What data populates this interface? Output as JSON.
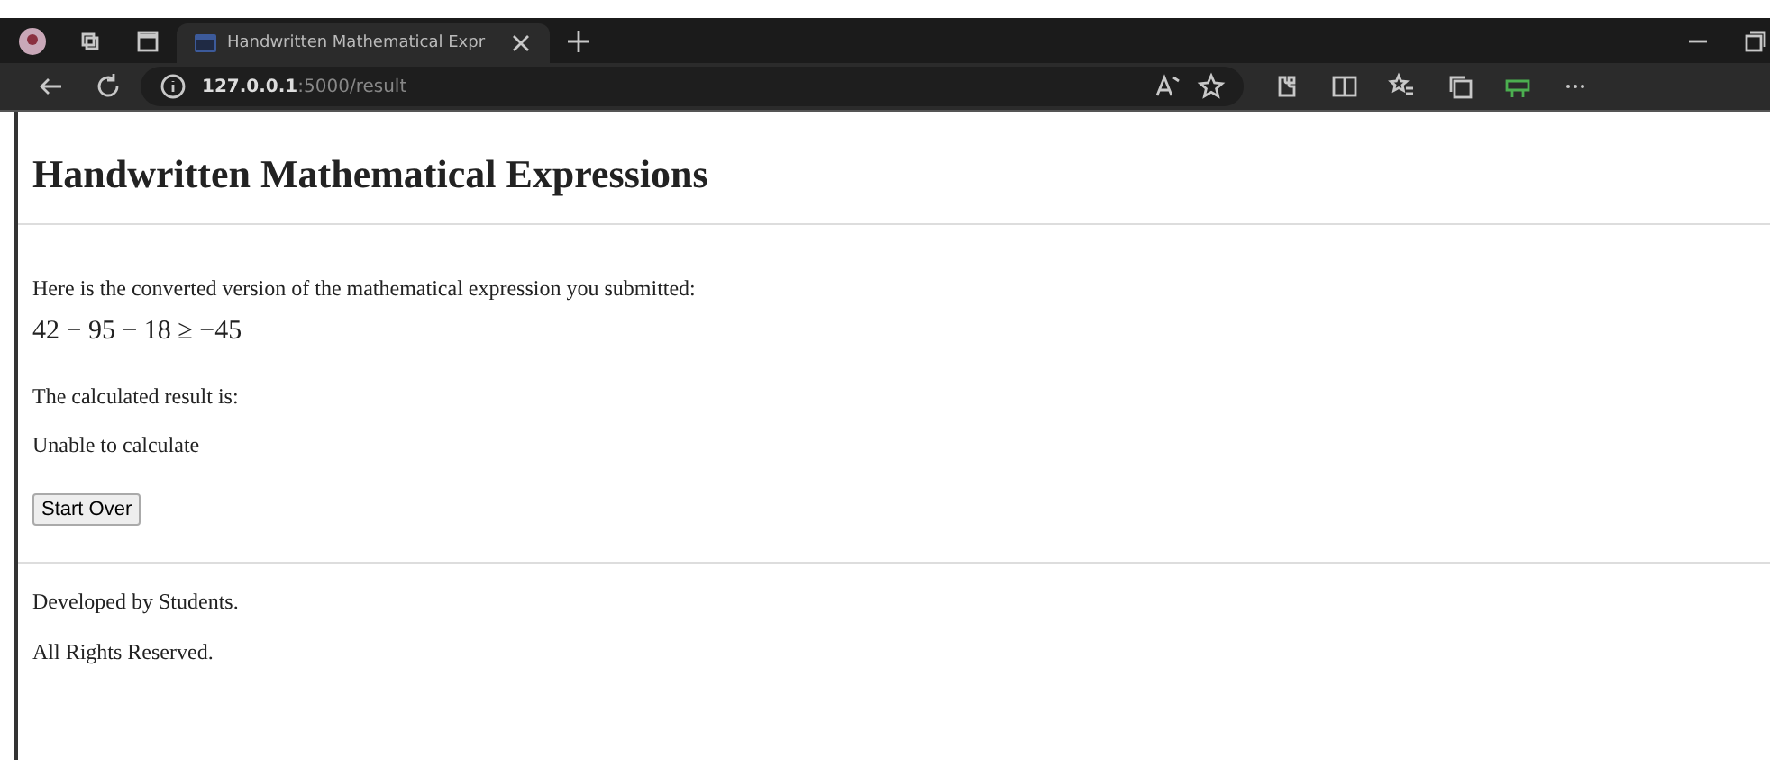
{
  "browser": {
    "tab": {
      "title": "Handwritten Mathematical Expr",
      "selected": true
    },
    "address": {
      "host": "127.0.0.1",
      "path": ":5000/result"
    }
  },
  "page": {
    "heading": "Handwritten Mathematical Expressions",
    "intro": "Here is the converted version of the mathematical expression you submitted:",
    "expression": "42 − 95 − 18 ≥ −45",
    "result_label": "The calculated result is:",
    "result": "Unable to calculate",
    "button": "Start Over",
    "footer": [
      "Developed by Students.",
      "All Rights Reserved."
    ]
  }
}
